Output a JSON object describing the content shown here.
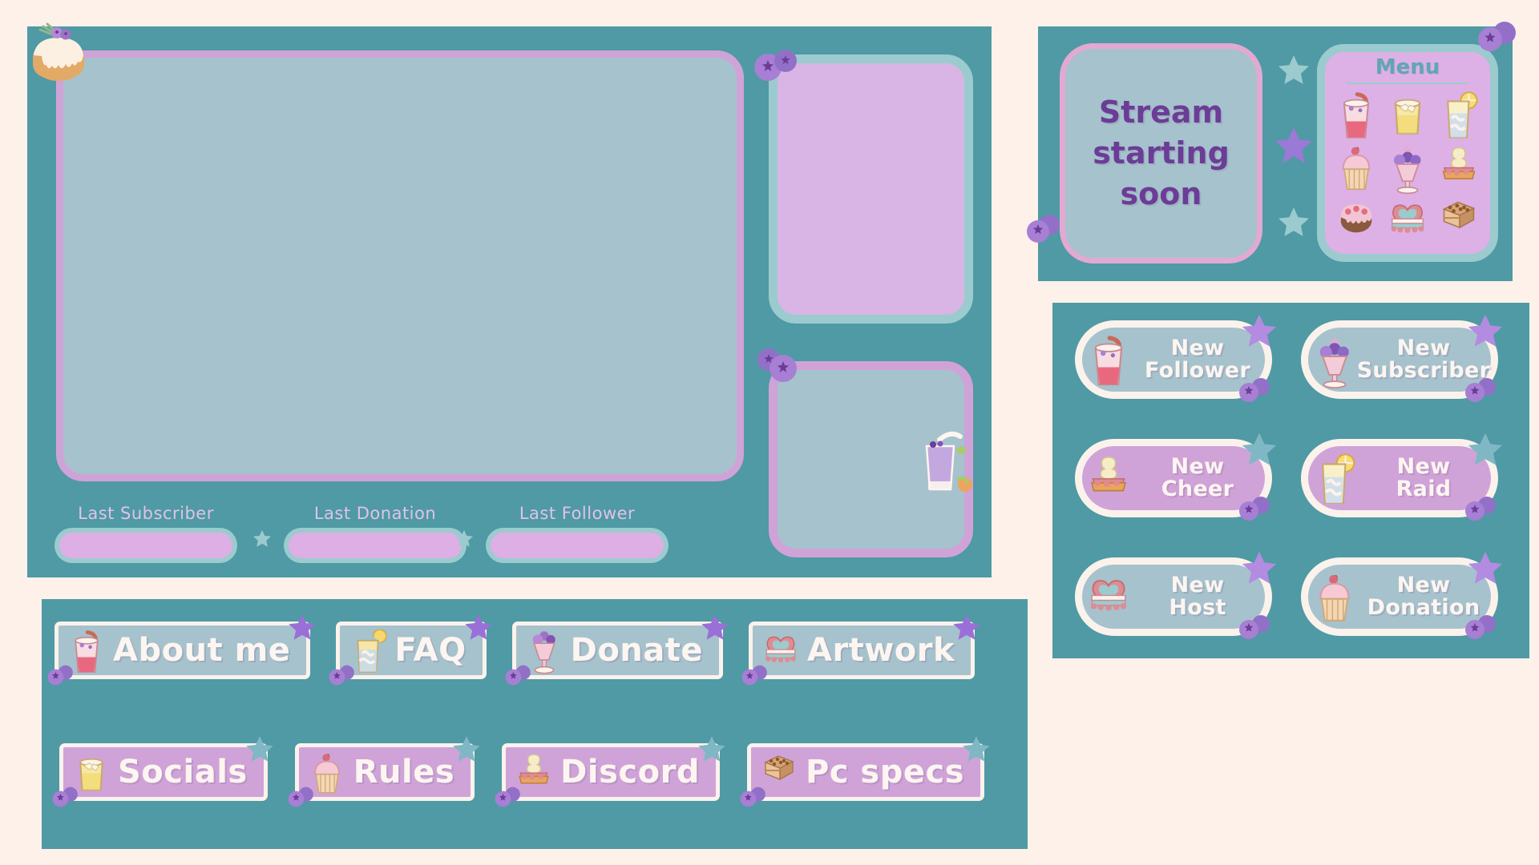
{
  "theme": {
    "background": "#FDF1EA",
    "panel_teal": "#4F9AA4",
    "blue_grey": "#A6C2CD",
    "lilac": "#CFA3D8",
    "light_lilac": "#DDB0E6",
    "mint": "#9BCBCF",
    "cream": "#FBF2EC",
    "purple_text": "#6B3D96",
    "menu_title_teal": "#5FA7B2",
    "label_lilac": "#E0C2E8",
    "pink_border": "#E2A9D2"
  },
  "main_panel": {
    "name": "Stream overlay / webcam frame",
    "webcam_placeholder": "",
    "alerts_placeholder": "",
    "chat_placeholder": "",
    "info_fields": [
      {
        "label": "Last Subscriber",
        "value": ""
      },
      {
        "label": "Last Donation",
        "value": ""
      },
      {
        "label": "Last Follower",
        "value": ""
      }
    ],
    "decorations": [
      "bundt-cake-icon",
      "blueberry-icon",
      "blueberry-icon",
      "lemonade-glass-icon",
      "star-icon",
      "star-icon"
    ]
  },
  "buttons_panel": {
    "row1": [
      {
        "label": "About me",
        "icon": "milkshake-icon",
        "style": "blue",
        "star": "purple"
      },
      {
        "label": "FAQ",
        "icon": "lemonade-icon",
        "style": "blue",
        "star": "purple"
      },
      {
        "label": "Donate",
        "icon": "parfait-icon",
        "style": "blue",
        "star": "purple"
      },
      {
        "label": "Artwork",
        "icon": "heart-cake-icon",
        "style": "blue",
        "star": "purple"
      }
    ],
    "row2": [
      {
        "label": "Socials",
        "icon": "lemon-drink-icon",
        "style": "lilac",
        "star": "teal"
      },
      {
        "label": "Rules",
        "icon": "cupcake-icon",
        "style": "lilac",
        "star": "teal"
      },
      {
        "label": "Discord",
        "icon": "cream-tart-icon",
        "style": "lilac",
        "star": "teal"
      },
      {
        "label": "Pc specs",
        "icon": "tiramisu-icon",
        "style": "lilac",
        "star": "teal"
      }
    ]
  },
  "starting_soon_panel": {
    "title_lines": [
      "Stream",
      "starting",
      "soon"
    ],
    "stars": [
      "mint-star-icon",
      "purple-star-icon",
      "mint-star-icon"
    ],
    "menu": {
      "title": "Menu",
      "items": [
        "strawberry-milkshake-icon",
        "lemon-drink-icon",
        "lemonade-glass-icon",
        "cherry-cupcake-icon",
        "blueberry-parfait-icon",
        "cream-tart-icon",
        "strawberry-bundt-icon",
        "heart-cake-icon",
        "tiramisu-icon"
      ]
    }
  },
  "alerts_panel": {
    "alerts": [
      {
        "line1": "New",
        "line2": "Follower",
        "icon": "strawberry-milkshake-icon",
        "style": "blue",
        "star": "purple"
      },
      {
        "line1": "New",
        "line2": "Subscriber",
        "icon": "blueberry-parfait-icon",
        "style": "blue",
        "star": "purple"
      },
      {
        "line1": "New",
        "line2": "Cheer",
        "icon": "cream-tart-icon",
        "style": "lilac",
        "star": "teal"
      },
      {
        "line1": "New",
        "line2": "Raid",
        "icon": "lemonade-glass-icon",
        "style": "lilac",
        "star": "teal"
      },
      {
        "line1": "New",
        "line2": "Host",
        "icon": "heart-cake-icon",
        "style": "blue",
        "star": "purple"
      },
      {
        "line1": "New",
        "line2": "Donation",
        "icon": "cherry-cupcake-icon",
        "style": "blue",
        "star": "purple"
      }
    ]
  }
}
